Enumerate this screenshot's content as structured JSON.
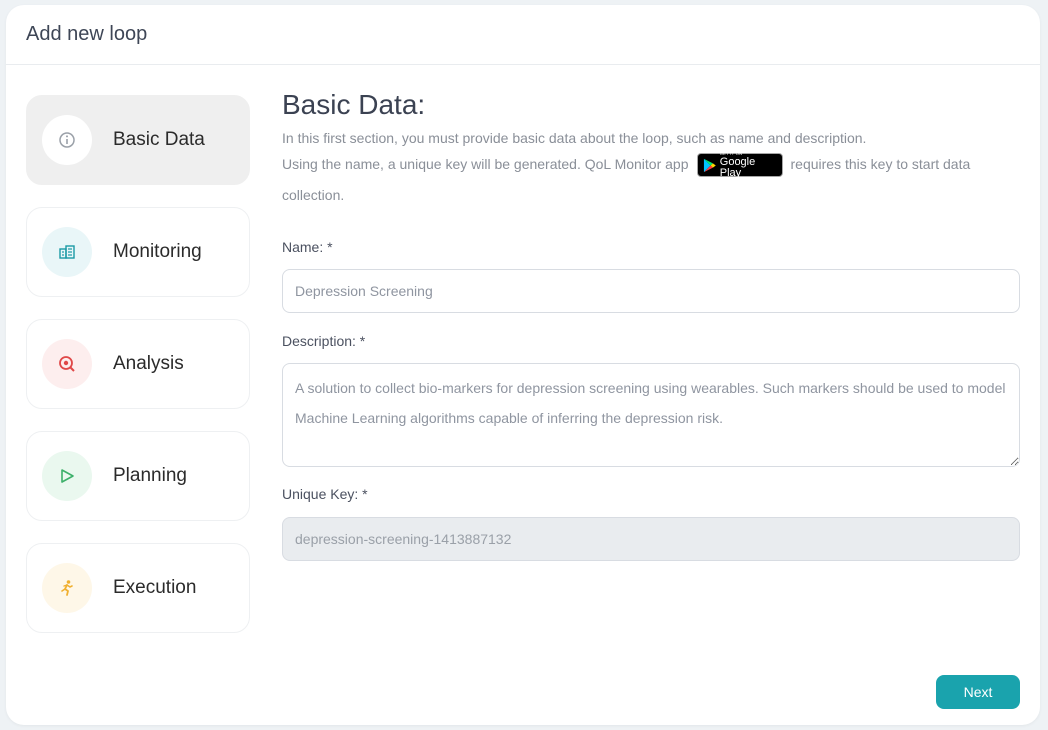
{
  "header": {
    "title": "Add new loop"
  },
  "steps": [
    {
      "label": "Basic Data",
      "icon": "info-icon",
      "active": true,
      "color": "#9aa0a8",
      "bg": "#ffffff"
    },
    {
      "label": "Monitoring",
      "icon": "building-chart-icon",
      "active": false,
      "color": "#1a9aa5",
      "bg": "#e9f6f8"
    },
    {
      "label": "Analysis",
      "icon": "target-search-icon",
      "active": false,
      "color": "#e04848",
      "bg": "#fdeeee"
    },
    {
      "label": "Planning",
      "icon": "play-icon",
      "active": false,
      "color": "#3db06a",
      "bg": "#eaf8ef"
    },
    {
      "label": "Execution",
      "icon": "running-person-icon",
      "active": false,
      "color": "#f0b030",
      "bg": "#fef7e8"
    }
  ],
  "main": {
    "title": "Basic Data:",
    "intro_line1": "In this first section, you must provide basic data about the loop, such as name and description.",
    "intro_line2_pre": "Using the name, a unique key will be generated. QoL Monitor app",
    "intro_line2_post": "requires this key to start data collection.",
    "google_play": {
      "small": "GET IT ON",
      "big": "Google Play"
    },
    "name_label": "Name: *",
    "name_value": "Depression Screening",
    "description_label": "Description: *",
    "description_value": "A solution to collect bio-markers for depression screening using wearables. Such markers should be used to model Machine Learning algorithms capable of inferring the depression risk.",
    "key_label": "Unique Key: *",
    "key_value": "depression-screening-1413887132"
  },
  "footer": {
    "next_label": "Next"
  },
  "colors": {
    "accent": "#1aa3ad"
  }
}
